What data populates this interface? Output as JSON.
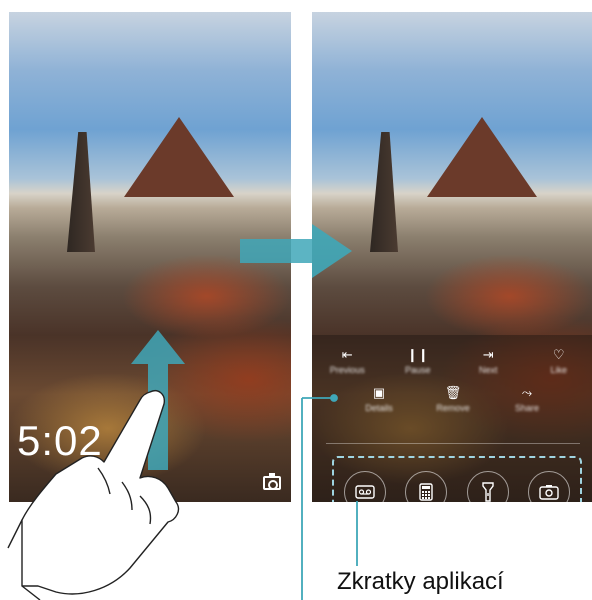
{
  "left_phone": {
    "clock": "5:02"
  },
  "right_phone": {
    "media_controls": [
      {
        "icon": "previous-icon",
        "glyph": "⇤",
        "label": "Previous"
      },
      {
        "icon": "pause-icon",
        "glyph": "❙❙",
        "label": "Pause"
      },
      {
        "icon": "next-icon",
        "glyph": "⇥",
        "label": "Next"
      },
      {
        "icon": "heart-icon",
        "glyph": "♡",
        "label": "Like"
      }
    ],
    "panel_shortcuts": [
      {
        "icon": "briefcase-icon",
        "glyph": "▣",
        "label": "Details"
      },
      {
        "icon": "trash-icon",
        "glyph": "🗑",
        "label": "Remove"
      },
      {
        "icon": "share-icon",
        "glyph": "⤳",
        "label": "Share"
      }
    ],
    "dock_apps": [
      {
        "icon": "recorder-icon"
      },
      {
        "icon": "calculator-icon"
      },
      {
        "icon": "flashlight-icon"
      },
      {
        "icon": "camera-icon"
      }
    ]
  },
  "caption": "Zkratky aplikací",
  "colors": {
    "arrow": "#3fa7b8",
    "callout": "#3fa7b8",
    "dock_border": "#9fd4e0"
  }
}
